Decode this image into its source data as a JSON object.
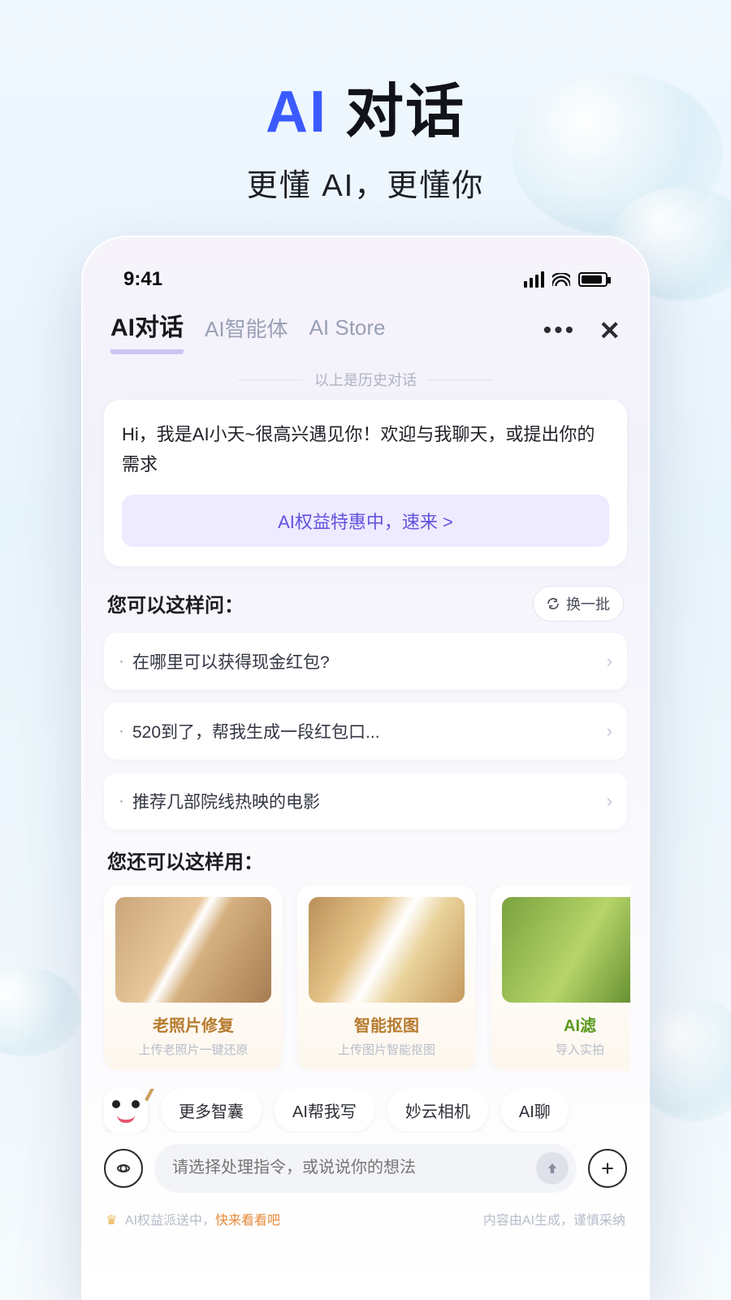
{
  "hero": {
    "ai": "AI",
    "rest": " 对话",
    "sub": "更懂 AI，更懂你"
  },
  "status": {
    "time": "9:41"
  },
  "tabs": {
    "t0": "AI对话",
    "t1": "AI智能体",
    "t2": "AI Store"
  },
  "historyDivider": "以上是历史对话",
  "greeting": "Hi，我是AI小天~很高兴遇见你！欢迎与我聊天，或提出你的需求",
  "promo": "AI权益特惠中，速来 >",
  "askTitle": "您可以这样问：",
  "refreshLabel": "换一批",
  "questions": {
    "q0": "在哪里可以获得现金红包?",
    "q1": "520到了，帮我生成一段红包口...",
    "q2": "推荐几部院线热映的电影"
  },
  "useTitle": "您还可以这样用：",
  "features": {
    "f0": {
      "title": "老照片修复",
      "sub": "上传老照片一键还原"
    },
    "f1": {
      "title": "智能抠图",
      "sub": "上传图片智能抠图"
    },
    "f2": {
      "title": "AI滤",
      "sub": "导入实拍"
    }
  },
  "chips": {
    "c0": "更多智囊",
    "c1": "AI帮我写",
    "c2": "妙云相机",
    "c3": "AI聊"
  },
  "input": {
    "placeholder": "请选择处理指令，或说说你的想法"
  },
  "footer": {
    "left1": "AI权益派送中，",
    "leftLink": "快来看看吧",
    "right": "内容由AI生成，谨慎采纳"
  }
}
